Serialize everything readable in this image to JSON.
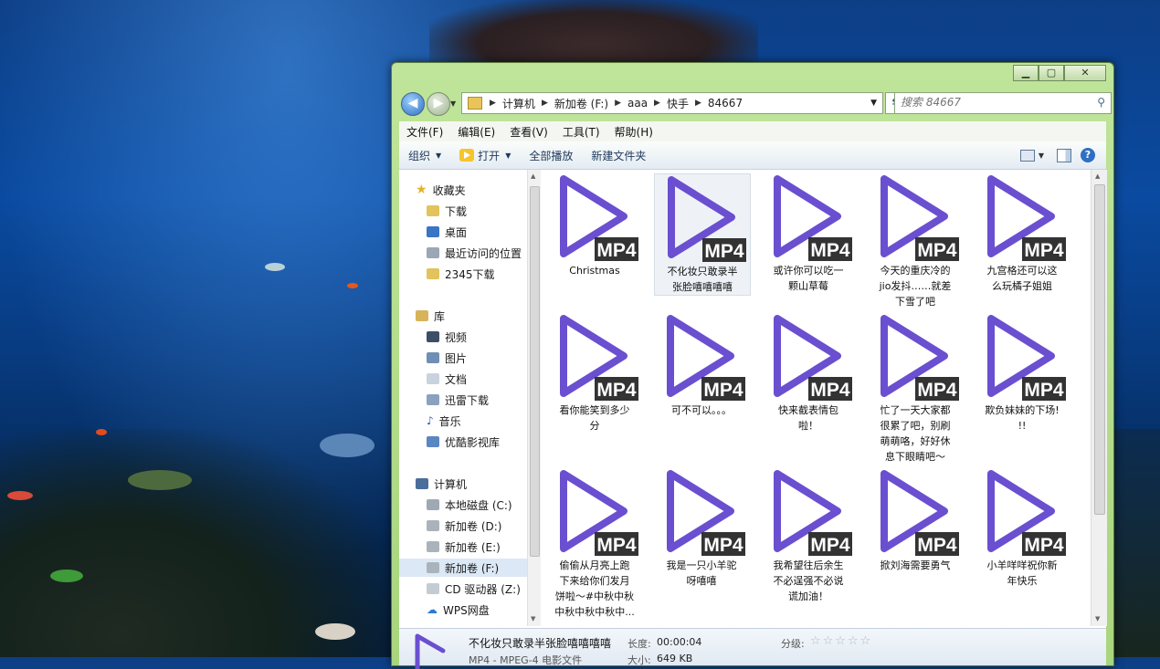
{
  "explorer": {
    "window_controls": {
      "minimize": "▁",
      "maximize": "▢",
      "close": "✕"
    },
    "breadcrumbs": [
      "计算机",
      "新加卷 (F:)",
      "aaa",
      "快手",
      "84667"
    ],
    "search_placeholder": "搜索 84667",
    "menu": [
      "文件(F)",
      "编辑(E)",
      "查看(V)",
      "工具(T)",
      "帮助(H)"
    ],
    "toolbar": {
      "organize": "组织",
      "open": "打开",
      "play_all": "全部播放",
      "new_folder": "新建文件夹",
      "help": "?"
    },
    "nav": {
      "favorites": "收藏夹",
      "fav_items": [
        "下载",
        "桌面",
        "最近访问的位置",
        "2345下载"
      ],
      "libraries": "库",
      "lib_items": [
        "视频",
        "图片",
        "文档",
        "迅雷下载",
        "音乐",
        "优酷影视库"
      ],
      "computer": "计算机",
      "drives": [
        "本地磁盘 (C:)",
        "新加卷 (D:)",
        "新加卷 (E:)",
        "新加卷 (F:)",
        "CD 驱动器 (Z:)",
        "WPS网盘"
      ]
    },
    "badge": "MP4",
    "files": [
      {
        "lines": [
          "Christmas"
        ]
      },
      {
        "lines": [
          "不化妆只敢录半",
          "张脸嘻嘻嘻嘻"
        ]
      },
      {
        "lines": [
          "或许你可以吃一",
          "颗山草莓"
        ]
      },
      {
        "lines": [
          "今天的重庆冷的",
          "jio发抖……就差",
          "下雪了吧"
        ]
      },
      {
        "lines": [
          "九宫格还可以这",
          "么玩橘子姐姐"
        ]
      },
      {
        "lines": [
          "看你能笑到多少",
          "分"
        ]
      },
      {
        "lines": [
          "可不可以。。。"
        ]
      },
      {
        "lines": [
          "快来截表情包",
          "啦！"
        ]
      },
      {
        "lines": [
          "忙了一天大家都",
          "很累了吧，别刷",
          "萌萌咯，好好休",
          "息下眼睛吧～"
        ]
      },
      {
        "lines": [
          "欺负妹妹的下场!",
          "!!"
        ]
      },
      {
        "lines": [
          "偷偷从月亮上跑",
          "下来给你们发月",
          "饼啦～#中秋中秋",
          "中秋中秋中秋中..."
        ]
      },
      {
        "lines": [
          "我是一只小羊驼",
          "呀嘻嘻"
        ]
      },
      {
        "lines": [
          "我希望往后余生",
          "不必逞强不必说",
          "谎加油！"
        ]
      },
      {
        "lines": [
          "掀刘海需要勇气"
        ]
      },
      {
        "lines": [
          "小羊咩咩祝你新",
          "年快乐"
        ]
      }
    ],
    "selected_index": 1,
    "details": {
      "name": "不化妆只敢录半张脸嘻嘻嘻嘻",
      "type": "MP4 - MPEG-4 电影文件",
      "length_label": "长度:",
      "length": "00:00:04",
      "size_label": "大小:",
      "size": "649 KB",
      "rating_label": "分级:",
      "rating_stars": "☆☆☆☆☆"
    },
    "colors": {
      "play_icon": "#6a4fd0",
      "badge_bg": "#333333",
      "badge_text": "#ffffff"
    }
  }
}
